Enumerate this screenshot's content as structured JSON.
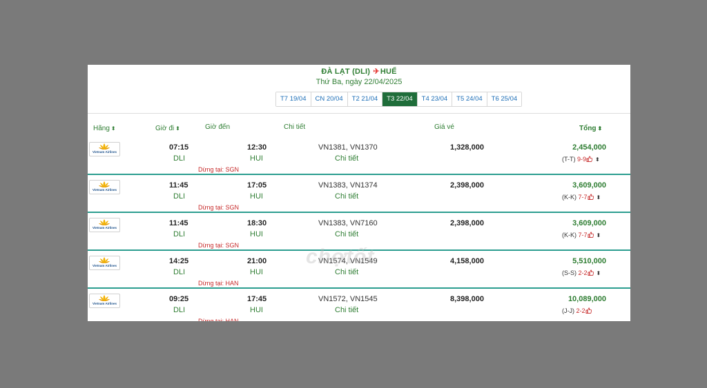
{
  "header": {
    "origin": "ĐÀ LẠT (DLI)",
    "destination": "HUẾ",
    "date": "Thứ Ba, ngày 22/04/2025",
    "day_tabs": [
      {
        "label": "T7 19/04",
        "active": false
      },
      {
        "label": "CN 20/04",
        "active": false
      },
      {
        "label": "T2 21/04",
        "active": false
      },
      {
        "label": "T3 22/04",
        "active": true
      },
      {
        "label": "T4 23/04",
        "active": false
      },
      {
        "label": "T5 24/04",
        "active": false
      },
      {
        "label": "T6 25/04",
        "active": false
      }
    ]
  },
  "columns": {
    "airline": "Hãng",
    "depart": "Giờ đi",
    "arrive": "Giờ đến",
    "detail": "Chi tiết",
    "fare": "Giá vé",
    "total": "Tổng"
  },
  "airline_logo_text": "Vietnam Airlines",
  "watermark": "chợtốt",
  "flights": [
    {
      "depart_time": "07:15",
      "depart_code": "DLI",
      "stopover": "Dừng tại: SGN",
      "arrive_time": "12:30",
      "arrive_code": "HUI",
      "flights": "VN1381, VN1370",
      "detail_link": "Chi tiết",
      "fare": "1,328,000",
      "total": "2,454,000",
      "fare_class": "(T-T)",
      "seats": "9-9"
    },
    {
      "depart_time": "11:45",
      "depart_code": "DLI",
      "stopover": "Dừng tại: SGN",
      "arrive_time": "17:05",
      "arrive_code": "HUI",
      "flights": "VN1383, VN1374",
      "detail_link": "Chi tiết",
      "fare": "2,398,000",
      "total": "3,609,000",
      "fare_class": "(K-K)",
      "seats": "7-7"
    },
    {
      "depart_time": "11:45",
      "depart_code": "DLI",
      "stopover": "Dừng tại: SGN",
      "arrive_time": "18:30",
      "arrive_code": "HUI",
      "flights": "VN1383, VN7160",
      "detail_link": "Chi tiết",
      "fare": "2,398,000",
      "total": "3,609,000",
      "fare_class": "(K-K)",
      "seats": "7-7"
    },
    {
      "depart_time": "14:25",
      "depart_code": "DLI",
      "stopover": "Dừng tại: HAN",
      "arrive_time": "21:00",
      "arrive_code": "HUI",
      "flights": "VN1574, VN1549",
      "detail_link": "Chi tiết",
      "fare": "4,158,000",
      "total": "5,510,000",
      "fare_class": "(S-S)",
      "seats": "2-2"
    },
    {
      "depart_time": "09:25",
      "depart_code": "DLI",
      "stopover": "Dừng tại: HAN",
      "arrive_time": "17:45",
      "arrive_code": "HUI",
      "flights": "VN1572, VN1545",
      "detail_link": "Chi tiết",
      "fare": "8,398,000",
      "total": "10,089,000",
      "fare_class": "(J-J)",
      "seats": "2-2"
    }
  ],
  "icons": {
    "plane": "plane-icon",
    "sort": "sort-icon",
    "thumb": "thumbs-up-icon",
    "caret": "expand-caret-icon"
  },
  "colors": {
    "accent": "#2e7d32",
    "active_tab": "#1f6d3a",
    "divider": "#2a9d8f",
    "alert": "#c62828"
  }
}
